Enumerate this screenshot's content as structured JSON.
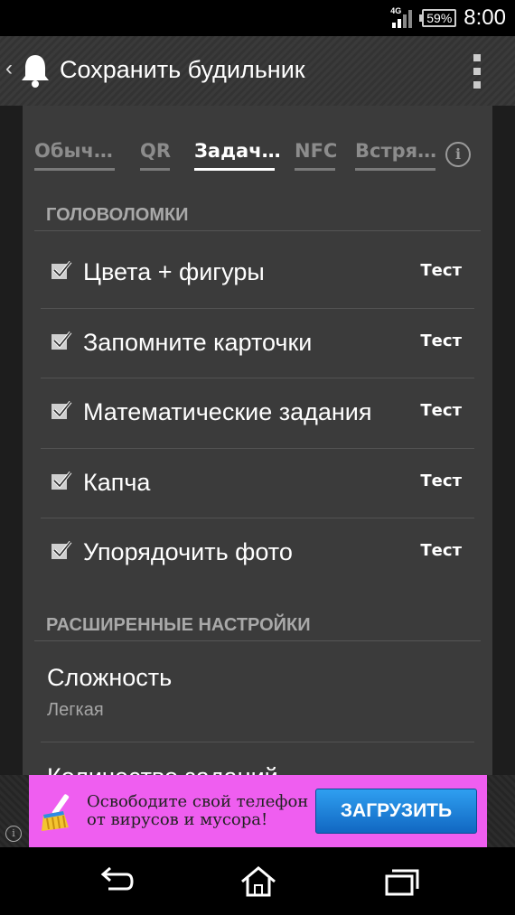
{
  "status": {
    "network": "4G",
    "battery": "59%",
    "time": "8:00"
  },
  "header": {
    "title": "Сохранить будильник"
  },
  "tabs": [
    {
      "label": "Обыч…"
    },
    {
      "label": "QR"
    },
    {
      "label": "Задач…"
    },
    {
      "label": "NFC"
    },
    {
      "label": "Встря…"
    }
  ],
  "info_glyph": "i",
  "puzzles": {
    "heading": "ГОЛОВОЛОМКИ",
    "items": [
      {
        "label": "Цвета + фигуры",
        "test": "Тест",
        "checked": true
      },
      {
        "label": "Запомните карточки",
        "test": "Тест",
        "checked": true
      },
      {
        "label": "Математические задания",
        "test": "Тест",
        "checked": true
      },
      {
        "label": "Капча",
        "test": "Тест",
        "checked": true
      },
      {
        "label": "Упорядочить фото",
        "test": "Тест",
        "checked": true
      }
    ]
  },
  "advanced": {
    "heading": "РАСШИРЕННЫЕ НАСТРОЙКИ",
    "difficulty_title": "Сложность",
    "difficulty_value": "Легкая",
    "next_item_partial": "Количество заданий"
  },
  "ad": {
    "line1": "Освободите свой телефон",
    "line2": "от вирусов и мусора!",
    "button": "ЗАГРУЗИТЬ",
    "info_glyph": "i",
    "bg_color": "#ef5ef0",
    "button_color": "#1e7fd8"
  }
}
